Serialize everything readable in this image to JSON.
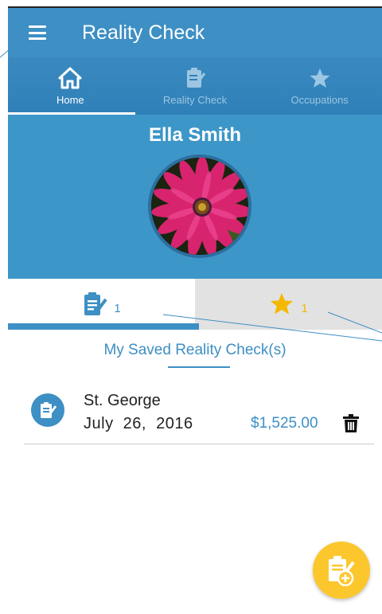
{
  "appbar": {
    "title": "Reality Check"
  },
  "tabs": [
    {
      "label": "Home",
      "icon": "home-icon",
      "active": true
    },
    {
      "label": "Reality Check",
      "icon": "checklist-icon",
      "active": false
    },
    {
      "label": "Occupations",
      "icon": "star-icon",
      "active": false
    }
  ],
  "profile": {
    "name": "Ella Smith",
    "avatar": "flower-photo"
  },
  "subtabs": {
    "reality_checks": {
      "icon": "checklist-icon",
      "count": "1"
    },
    "occupations": {
      "icon": "star-icon",
      "count": "1"
    }
  },
  "section": {
    "title": "My Saved Reality Check(s)"
  },
  "saved": [
    {
      "name": "St. George",
      "date": "July  26,  2016",
      "amount": "$1,525.00",
      "icon": "checklist-icon"
    }
  ],
  "fab": {
    "icon": "add-reality-check-icon"
  },
  "colors": {
    "primary": "#3d8fc4",
    "accent": "#fcc72d",
    "star": "#f5b800"
  }
}
